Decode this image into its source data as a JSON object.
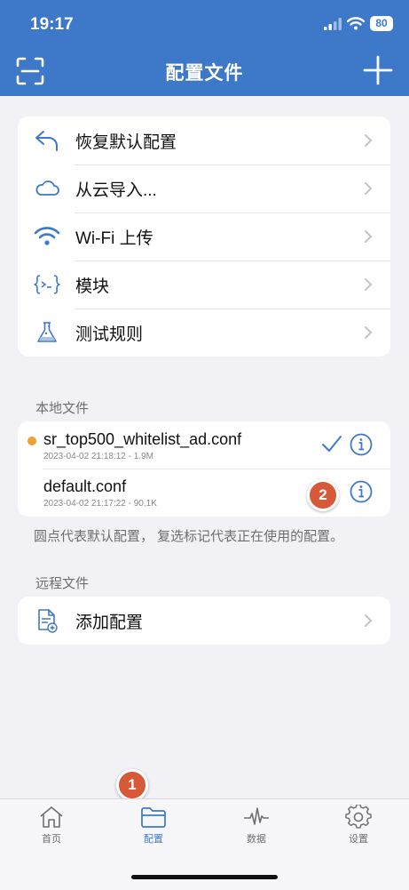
{
  "status": {
    "time": "19:17",
    "battery": "80"
  },
  "header": {
    "title": "配置文件"
  },
  "menu": {
    "items": [
      {
        "label": "恢复默认配置",
        "icon": "undo-icon"
      },
      {
        "label": "从云导入...",
        "icon": "cloud-icon"
      },
      {
        "label": "Wi-Fi 上传",
        "icon": "wifi-icon"
      },
      {
        "label": "模块",
        "icon": "module-icon"
      },
      {
        "label": "测试规则",
        "icon": "flask-icon"
      }
    ]
  },
  "local": {
    "title": "本地文件",
    "files": [
      {
        "name": "sr_top500_whitelist_ad.conf",
        "meta": "2023-04-02 21:18:12 - 1.9M",
        "default": true,
        "selected": true
      },
      {
        "name": "default.conf",
        "meta": "2023-04-02 21:17:22 - 90.1K",
        "default": false,
        "selected": false
      }
    ],
    "note": "圆点代表默认配置， 复选标记代表正在使用的配置。"
  },
  "remote": {
    "title": "远程文件",
    "add_label": "添加配置"
  },
  "badges": {
    "one": "1",
    "two": "2"
  },
  "tabs": [
    {
      "label": "首页",
      "icon": "home-icon"
    },
    {
      "label": "配置",
      "icon": "folder-icon"
    },
    {
      "label": "数据",
      "icon": "activity-icon"
    },
    {
      "label": "设置",
      "icon": "gear-icon"
    }
  ],
  "colors": {
    "accent": "#3e78c9",
    "dot": "#f0a030",
    "badge": "#d65a3a"
  }
}
